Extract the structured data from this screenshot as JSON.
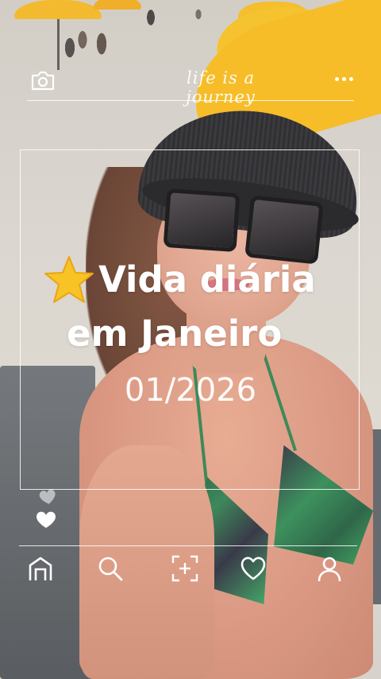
{
  "overlay": {
    "tagline": "life is a journey",
    "title_line1": "Vida diária",
    "title_line2": "em Janeiro",
    "date": "01/2026"
  },
  "icons": {
    "top_left": "camera-icon",
    "top_right": "more-icon",
    "title_emoji": "star-icon",
    "side": "hearts-icon",
    "nav": [
      "home-icon",
      "search-icon",
      "add-icon",
      "heart-icon",
      "profile-icon"
    ]
  },
  "colors": {
    "overlay_text": "#ffffff",
    "star": "#f7c325",
    "umbrella": "#f5b81c"
  }
}
